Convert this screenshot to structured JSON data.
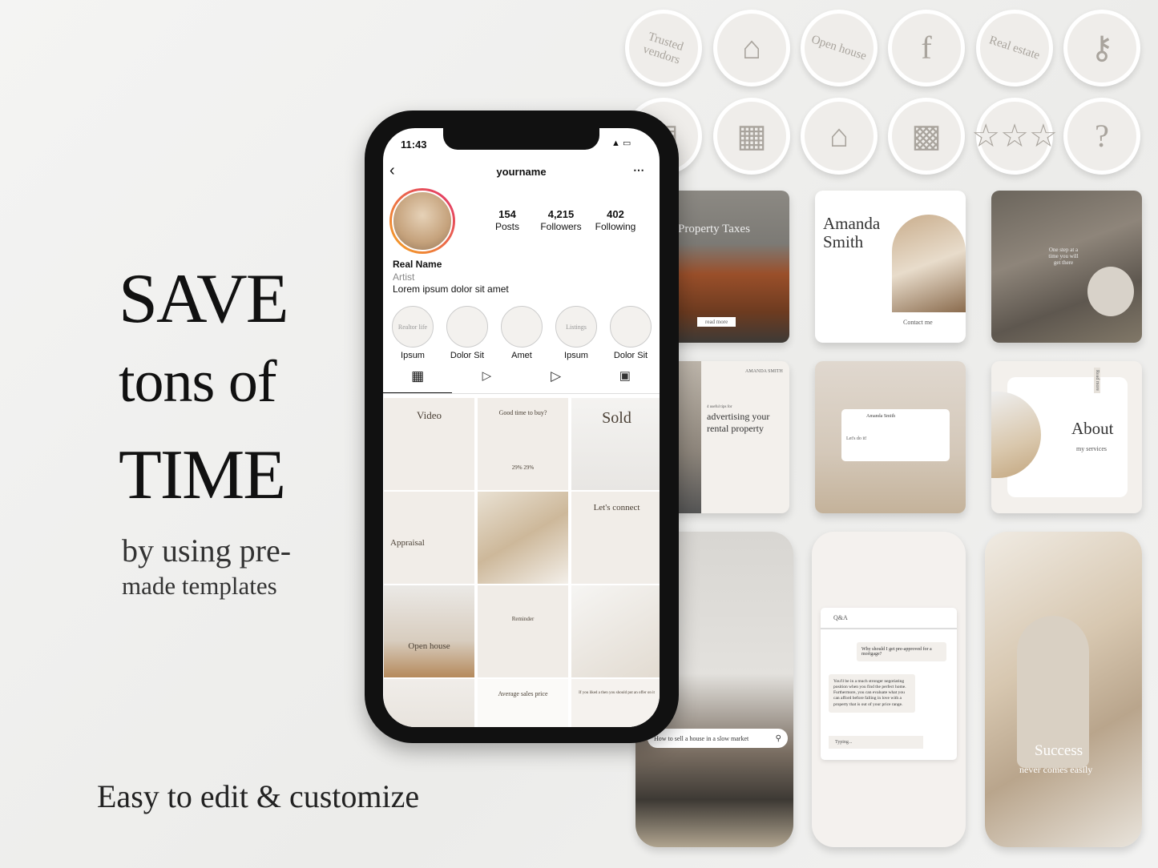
{
  "headline": {
    "line1": "SAVE",
    "line2": "tons of",
    "line3": "TIME",
    "line4": "by using pre-",
    "line5": "made templates"
  },
  "tagline": "Easy to edit & customize",
  "highlight_covers": [
    {
      "label": "Trusted vendors",
      "icon": "text"
    },
    {
      "label": "",
      "icon": "house-pencil-icon"
    },
    {
      "label": "Open house",
      "icon": "text"
    },
    {
      "label": "",
      "icon": "facebook-icon"
    },
    {
      "label": "Real estate",
      "icon": "text"
    },
    {
      "label": "",
      "icon": "key-house-icon"
    },
    {
      "label": "",
      "icon": "document-icon"
    },
    {
      "label": "",
      "icon": "building-icon"
    },
    {
      "label": "",
      "icon": "house-search-icon"
    },
    {
      "label": "",
      "icon": "desk-icon"
    },
    {
      "label": "",
      "icon": "stars-icon"
    },
    {
      "label": "",
      "icon": "chat-question-icon"
    }
  ],
  "phone": {
    "time": "11:43",
    "username": "yourname",
    "stats": [
      {
        "value": "154",
        "label": "Posts"
      },
      {
        "value": "4,215",
        "label": "Followers"
      },
      {
        "value": "402",
        "label": "Following"
      }
    ],
    "name": "Real Name",
    "category": "Artist",
    "bio": "Lorem ipsum dolor sit amet",
    "highlights": [
      {
        "label": "Ipsum",
        "cover": "Realtor life"
      },
      {
        "label": "Dolor Sit",
        "cover": ""
      },
      {
        "label": "Amet",
        "cover": ""
      },
      {
        "label": "Ipsum",
        "cover": "Listings"
      },
      {
        "label": "Dolor Sit",
        "cover": ""
      }
    ],
    "grid": [
      "Video",
      "Good time to buy?",
      "Sold",
      "Appraisal",
      "",
      "Let's connect",
      "Open house",
      "Reminder",
      "",
      "",
      "Average sales price",
      "If you liked a then you should put an offer on it"
    ],
    "grid_extra": {
      "percent_a": "29%",
      "percent_b": "29%"
    }
  },
  "posts": [
    {
      "title": "Property Taxes",
      "button": "read more"
    },
    {
      "title": "Amanda Smith",
      "subtitle": "Contact me"
    },
    {
      "title": "One step at a time you will get there"
    },
    {
      "kicker": "4 useful tips for",
      "title": "advertising your rental property",
      "brand": "AMANDA SMITH"
    },
    {
      "name": "Amanda Smith",
      "cta": "Let's do it!"
    },
    {
      "title": "About",
      "subtitle": "my services",
      "tab": "Read more"
    }
  ],
  "stories": [
    {
      "search": "How to sell a house in a slow market"
    },
    {
      "header": "Q&A",
      "question": "Why should I get pre-approved for a mortgage?",
      "answer": "You'll be in a much stronger negotiating position when you find the perfect home. Furthermore, you can evaluate what you can afford before falling in love with a property that is out of your price range.",
      "input": "Typing..."
    },
    {
      "title": "Success",
      "subtitle": "never comes easily"
    }
  ]
}
